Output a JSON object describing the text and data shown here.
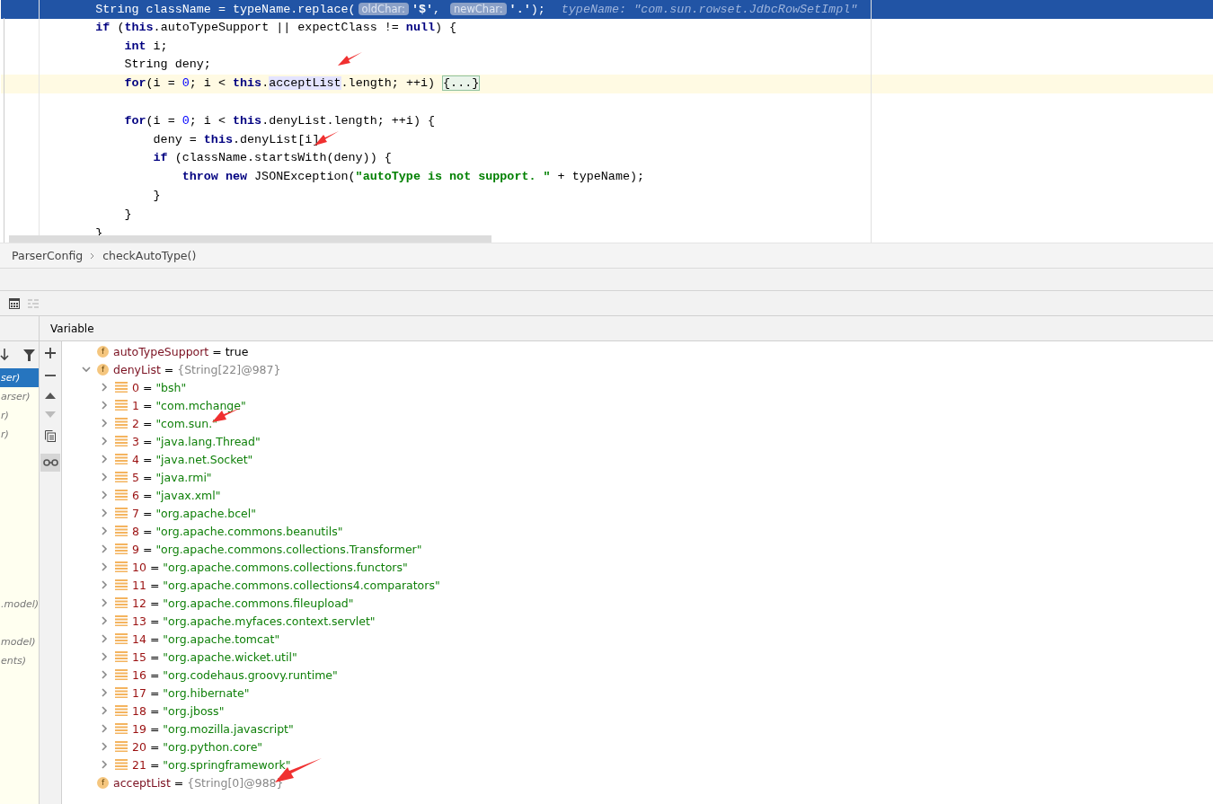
{
  "editor": {
    "lines": [
      {
        "kind": "execution",
        "tokens": [
          {
            "kind": "plain",
            "text": "        String className = typeName.replace("
          },
          {
            "kind": "hint",
            "text": "oldChar:"
          },
          {
            "kind": "str",
            "text": "'$'"
          },
          {
            "kind": "plain",
            "text": ", "
          },
          {
            "kind": "hint",
            "text": "newChar:"
          },
          {
            "kind": "str",
            "text": "'.'"
          },
          {
            "kind": "plain",
            "text": ");"
          },
          {
            "kind": "inline",
            "text": "typeName: \"com.sun.rowset.JdbcRowSetImpl\""
          }
        ]
      },
      {
        "kind": "normal",
        "tokens": [
          {
            "kind": "kw",
            "text": "        if"
          },
          {
            "kind": "plain",
            "text": " ("
          },
          {
            "kind": "kw",
            "text": "this"
          },
          {
            "kind": "plain",
            "text": ".autoTypeSupport || expectClass != "
          },
          {
            "kind": "kw",
            "text": "null"
          },
          {
            "kind": "plain",
            "text": ") {"
          }
        ]
      },
      {
        "kind": "normal",
        "tokens": [
          {
            "kind": "kw",
            "text": "            int"
          },
          {
            "kind": "plain",
            "text": " i;"
          }
        ]
      },
      {
        "kind": "normal",
        "tokens": [
          {
            "kind": "plain",
            "text": "            String deny;"
          }
        ]
      },
      {
        "kind": "caret",
        "tokens": [
          {
            "kind": "kw",
            "text": "            for"
          },
          {
            "kind": "plain",
            "text": "(i = "
          },
          {
            "kind": "num",
            "text": "0"
          },
          {
            "kind": "plain",
            "text": "; i < "
          },
          {
            "kind": "kw",
            "text": "this"
          },
          {
            "kind": "plain",
            "text": "."
          },
          {
            "kind": "usage",
            "text": "acceptList"
          },
          {
            "kind": "plain",
            "text": ".length; ++i) "
          },
          {
            "kind": "fold",
            "text": "{...}"
          }
        ]
      },
      {
        "kind": "normal"
      },
      {
        "kind": "normal",
        "tokens": [
          {
            "kind": "kw",
            "text": "            for"
          },
          {
            "kind": "plain",
            "text": "(i = "
          },
          {
            "kind": "num",
            "text": "0"
          },
          {
            "kind": "plain",
            "text": "; i < "
          },
          {
            "kind": "kw",
            "text": "this"
          },
          {
            "kind": "plain",
            "text": ".denyList.length; ++i) {"
          }
        ]
      },
      {
        "kind": "normal",
        "tokens": [
          {
            "kind": "plain",
            "text": "                deny = "
          },
          {
            "kind": "kw",
            "text": "this"
          },
          {
            "kind": "plain",
            "text": ".denyList[i]"
          }
        ]
      },
      {
        "kind": "normal",
        "tokens": [
          {
            "kind": "kw",
            "text": "                if"
          },
          {
            "kind": "plain",
            "text": " (className.startsWith(deny)) {"
          }
        ]
      },
      {
        "kind": "normal",
        "tokens": [
          {
            "kind": "kw",
            "text": "                    throw new"
          },
          {
            "kind": "plain",
            "text": " JSONException("
          },
          {
            "kind": "str",
            "text": "\"autoType is not support. \""
          },
          {
            "kind": "plain",
            "text": " + typeName);"
          }
        ]
      },
      {
        "kind": "normal",
        "tokens": [
          {
            "kind": "plain",
            "text": "                }"
          }
        ]
      },
      {
        "kind": "normal",
        "tokens": [
          {
            "kind": "plain",
            "text": "            }"
          }
        ]
      },
      {
        "kind": "normal",
        "tokens": [
          {
            "kind": "plain",
            "text": "        }"
          }
        ]
      }
    ]
  },
  "breadcrumb": [
    "ParserConfig",
    "checkAutoType()"
  ],
  "debugger": {
    "header": "Variable",
    "frames": [
      {
        "label": "ser)",
        "selected": true
      },
      {
        "label": "arser)",
        "selected": false
      },
      {
        "label": "r)",
        "selected": false
      },
      {
        "label": "r)",
        "selected": false
      },
      {
        "selected": false
      },
      {
        "selected": false
      },
      {
        "selected": false
      },
      {
        "selected": false
      },
      {
        "selected": false
      },
      {
        "selected": false
      },
      {
        "selected": false
      },
      {
        "selected": false
      },
      {
        "label": ".model)",
        "selected": false
      },
      {
        "selected": false
      },
      {
        "label": "model)",
        "selected": false
      },
      {
        "label": "ents)",
        "selected": false
      }
    ],
    "variables": [
      {
        "kind": "field",
        "icon": "f",
        "name": "autoTypeSupport",
        "op": "=",
        "value": {
          "kind": "literal",
          "text": "true"
        }
      },
      {
        "kind": "field",
        "icon": "f",
        "name": "denyList",
        "op": "=",
        "value": {
          "kind": "object",
          "text": "{String[22]@987}"
        },
        "expanded": true,
        "children": [
          {
            "kind": "element",
            "name": "0",
            "op": "=",
            "value": {
              "kind": "string",
              "text": "\"bsh\""
            },
            "expanded": false
          },
          {
            "kind": "element",
            "name": "1",
            "op": "=",
            "value": {
              "kind": "string",
              "text": "\"com.mchange\""
            },
            "expanded": false
          },
          {
            "kind": "element",
            "name": "2",
            "op": "=",
            "value": {
              "kind": "string",
              "text": "\"com.sun.\""
            },
            "expanded": false
          },
          {
            "kind": "element",
            "name": "3",
            "op": "=",
            "value": {
              "kind": "string",
              "text": "\"java.lang.Thread\""
            },
            "expanded": false
          },
          {
            "kind": "element",
            "name": "4",
            "op": "=",
            "value": {
              "kind": "string",
              "text": "\"java.net.Socket\""
            },
            "expanded": false
          },
          {
            "kind": "element",
            "name": "5",
            "op": "=",
            "value": {
              "kind": "string",
              "text": "\"java.rmi\""
            },
            "expanded": false
          },
          {
            "kind": "element",
            "name": "6",
            "op": "=",
            "value": {
              "kind": "string",
              "text": "\"javax.xml\""
            },
            "expanded": false
          },
          {
            "kind": "element",
            "name": "7",
            "op": "=",
            "value": {
              "kind": "string",
              "text": "\"org.apache.bcel\""
            },
            "expanded": false
          },
          {
            "kind": "element",
            "name": "8",
            "op": "=",
            "value": {
              "kind": "string",
              "text": "\"org.apache.commons.beanutils\""
            },
            "expanded": false
          },
          {
            "kind": "element",
            "name": "9",
            "op": "=",
            "value": {
              "kind": "string",
              "text": "\"org.apache.commons.collections.Transformer\""
            },
            "expanded": false
          },
          {
            "kind": "element",
            "name": "10",
            "op": "=",
            "value": {
              "kind": "string",
              "text": "\"org.apache.commons.collections.functors\""
            },
            "expanded": false
          },
          {
            "kind": "element",
            "name": "11",
            "op": "=",
            "value": {
              "kind": "string",
              "text": "\"org.apache.commons.collections4.comparators\""
            },
            "expanded": false
          },
          {
            "kind": "element",
            "name": "12",
            "op": "=",
            "value": {
              "kind": "string",
              "text": "\"org.apache.commons.fileupload\""
            },
            "expanded": false
          },
          {
            "kind": "element",
            "name": "13",
            "op": "=",
            "value": {
              "kind": "string",
              "text": "\"org.apache.myfaces.context.servlet\""
            },
            "expanded": false
          },
          {
            "kind": "element",
            "name": "14",
            "op": "=",
            "value": {
              "kind": "string",
              "text": "\"org.apache.tomcat\""
            },
            "expanded": false
          },
          {
            "kind": "element",
            "name": "15",
            "op": "=",
            "value": {
              "kind": "string",
              "text": "\"org.apache.wicket.util\""
            },
            "expanded": false
          },
          {
            "kind": "element",
            "name": "16",
            "op": "=",
            "value": {
              "kind": "string",
              "text": "\"org.codehaus.groovy.runtime\""
            },
            "expanded": false
          },
          {
            "kind": "element",
            "name": "17",
            "op": "=",
            "value": {
              "kind": "string",
              "text": "\"org.hibernate\""
            },
            "expanded": false
          },
          {
            "kind": "element",
            "name": "18",
            "op": "=",
            "value": {
              "kind": "string",
              "text": "\"org.jboss\""
            },
            "expanded": false
          },
          {
            "kind": "element",
            "name": "19",
            "op": "=",
            "value": {
              "kind": "string",
              "text": "\"org.mozilla.javascript\""
            },
            "expanded": false
          },
          {
            "kind": "element",
            "name": "20",
            "op": "=",
            "value": {
              "kind": "string",
              "text": "\"org.python.core\""
            },
            "expanded": false
          },
          {
            "kind": "element",
            "name": "21",
            "op": "=",
            "value": {
              "kind": "string",
              "text": "\"org.springframework\""
            },
            "expanded": false
          }
        ]
      },
      {
        "kind": "field",
        "icon": "f",
        "name": "acceptList",
        "op": "=",
        "value": {
          "kind": "object",
          "text": "{String[0]@988}"
        }
      }
    ]
  }
}
